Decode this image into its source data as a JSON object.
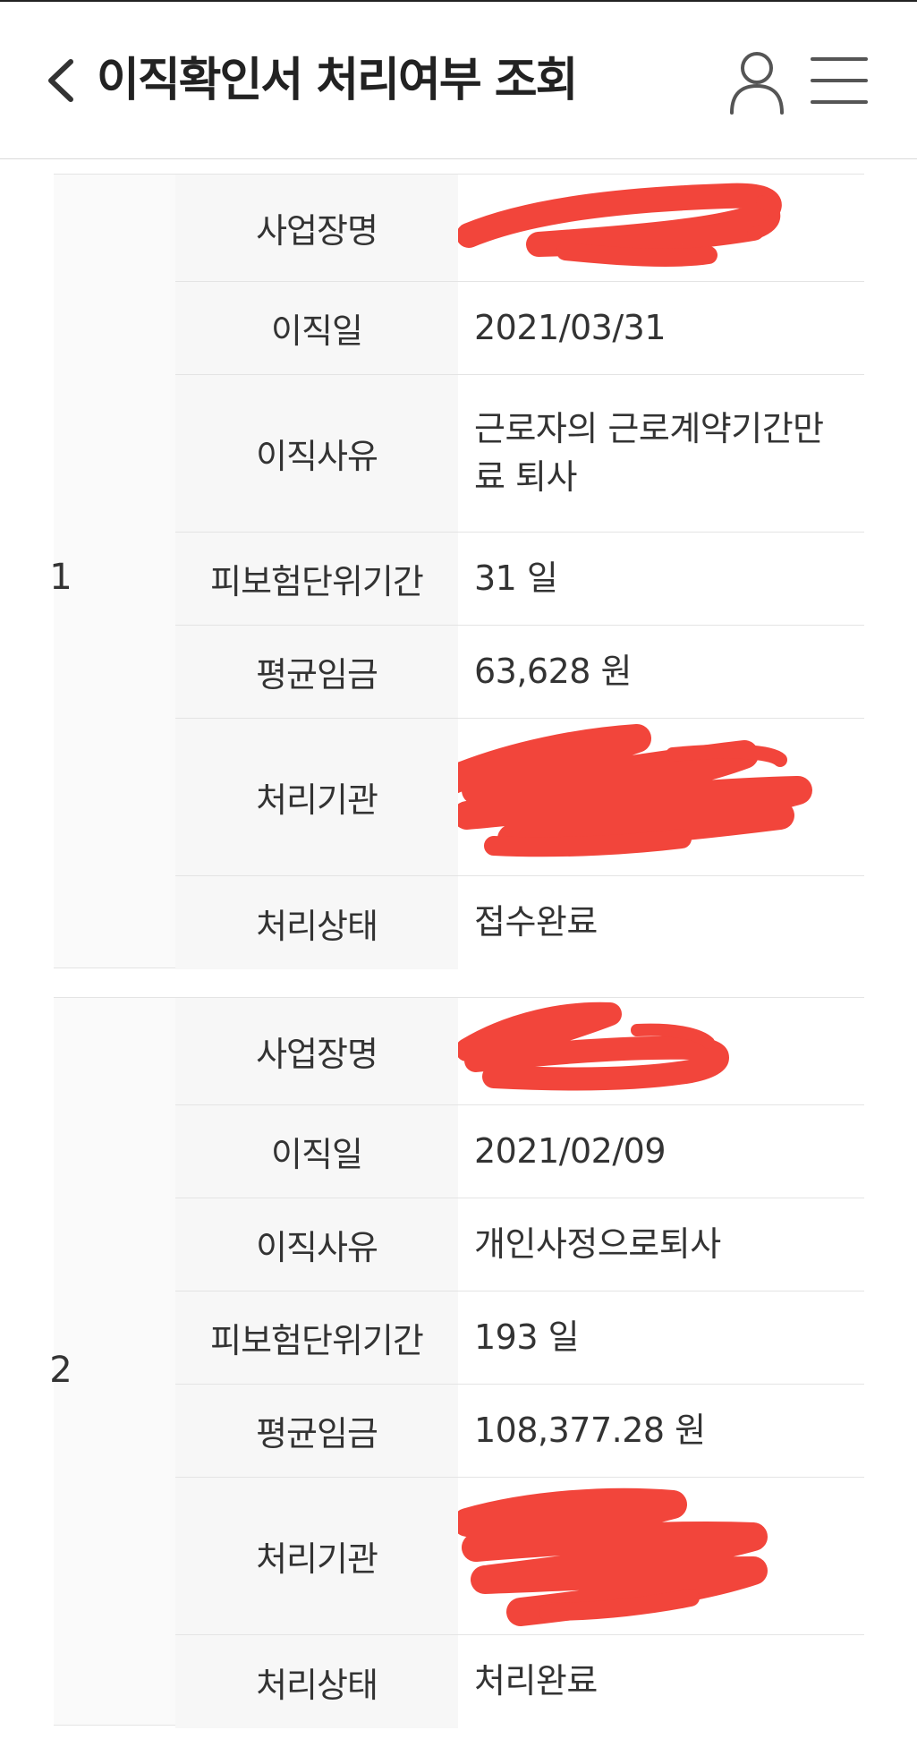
{
  "header": {
    "title": "이직확인서 처리여부 조회"
  },
  "icons": {
    "back": "chevron-left-icon",
    "user": "user-icon",
    "menu": "hamburger-menu-icon"
  },
  "colors": {
    "redaction": "#f2453b",
    "text": "#333333",
    "label_bg": "#f7f7f7"
  },
  "records": [
    {
      "no": "1",
      "rows": [
        {
          "label": "사업장명",
          "value": ""
        },
        {
          "label": "이직일",
          "value": "2021/03/31"
        },
        {
          "label": "이직사유",
          "value": "근로자의 근로계약기간만료 퇴사"
        },
        {
          "label": "피보험단위기간",
          "value": "31 일"
        },
        {
          "label": "평균임금",
          "value": "63,628 원"
        },
        {
          "label": "처리기관",
          "value": ""
        },
        {
          "label": "처리상태",
          "value": "접수완료"
        }
      ]
    },
    {
      "no": "2",
      "rows": [
        {
          "label": "사업장명",
          "value": ""
        },
        {
          "label": "이직일",
          "value": "2021/02/09"
        },
        {
          "label": "이직사유",
          "value": "개인사정으로퇴사"
        },
        {
          "label": "피보험단위기간",
          "value": "193 일"
        },
        {
          "label": "평균임금",
          "value": "108,377.28 원"
        },
        {
          "label": "처리기관",
          "value": ""
        },
        {
          "label": "처리상태",
          "value": "처리완료"
        }
      ]
    }
  ]
}
